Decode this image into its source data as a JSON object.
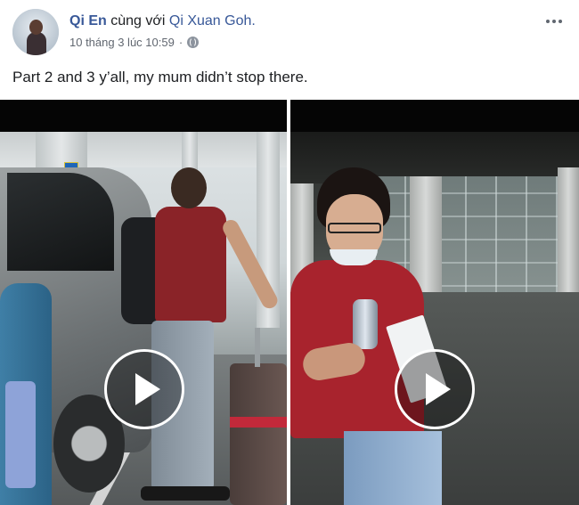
{
  "post": {
    "author": "Qi En",
    "with_text": "cùng với",
    "tagged_user": "Qi Xuan Goh.",
    "timestamp": "10 tháng 3 lúc 10:59",
    "separator": "·",
    "privacy_icon": "globe-icon",
    "more_icon": "more-options-icon",
    "text": "Part 2 and 3 y’all, my mum didn’t stop there."
  },
  "videos": [
    {
      "name": "video-1",
      "play_icon": "play-icon"
    },
    {
      "name": "video-2",
      "play_icon": "play-icon"
    }
  ],
  "colors": {
    "link": "#385898",
    "text": "#1c1e21",
    "meta": "#616770",
    "video_bar": "#050505"
  }
}
